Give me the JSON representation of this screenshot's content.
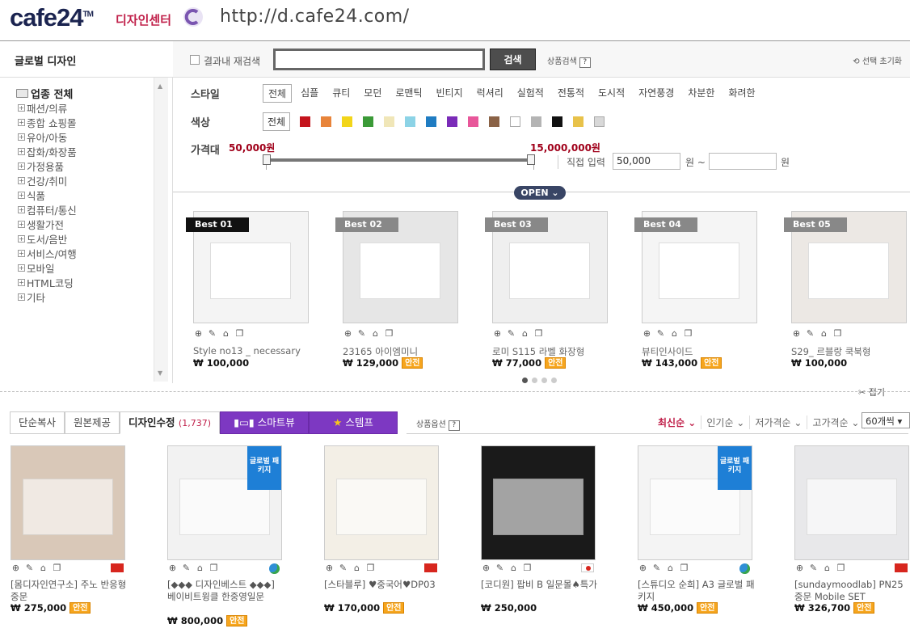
{
  "header": {
    "logo": "cafe24",
    "logo_tm": "TM",
    "logo_sub": "디자인센터",
    "url": "http://d.cafe24.com/"
  },
  "left": {
    "title": "글로벌 디자인",
    "root": "업종 전체",
    "categories": [
      "패션/의류",
      "종합 쇼핑몰",
      "유아/아동",
      "잡화/화장품",
      "가정용품",
      "건강/취미",
      "식품",
      "컴퓨터/통신",
      "생활가전",
      "도서/음반",
      "서비스/여행",
      "모바일",
      "HTML코딩",
      "기타"
    ]
  },
  "search": {
    "research_label": "결과내 재검색",
    "button": "검색",
    "product_search_label": "상품검색",
    "help": "?",
    "reset_label": "선택 초기화"
  },
  "filters": {
    "style_label": "스타일",
    "styles": [
      "전체",
      "심플",
      "큐티",
      "모던",
      "로맨틱",
      "빈티지",
      "럭셔리",
      "실험적",
      "전통적",
      "도시적",
      "자연풍경",
      "차분한",
      "화려한"
    ],
    "color_label": "색상",
    "color_all": "전체",
    "colors": [
      "#c4141c",
      "#e8843a",
      "#f2d51a",
      "#3b9a37",
      "#f0e6b8",
      "#8cd3e6",
      "#1f7cc2",
      "#7a2bb8",
      "#e8579a",
      "#8a6246",
      "#ffffff",
      "#b4b4b4",
      "#111111",
      "#e8c24a",
      "#d8d8d8"
    ],
    "price_label": "가격대",
    "price_min": "50,000원",
    "price_max": "15,000,000원",
    "direct_label": "직접 입력",
    "input_min": "50,000",
    "unit_from": "원 ~",
    "unit_to": "원",
    "open_label": "OPEN"
  },
  "best": [
    {
      "badge": "Best 01",
      "name": "Style no13 _ necessary",
      "price": "₩ 100,000",
      "safe": ""
    },
    {
      "badge": "Best 02",
      "name": "23165 아이엠미니",
      "price": "₩ 129,000",
      "safe": "안전"
    },
    {
      "badge": "Best 03",
      "name": "로미 S115 라벨 화장형",
      "price": "₩ 77,000",
      "safe": "안전"
    },
    {
      "badge": "Best 04",
      "name": "뷰티인사이드",
      "price": "₩ 143,000",
      "safe": "안전"
    },
    {
      "badge": "Best 05",
      "name": "S29_ 르블랑 쿡북형",
      "price": "₩ 100,000",
      "safe": ""
    }
  ],
  "fold_label": "접기",
  "tabs": {
    "simple_copy": "단순복사",
    "original": "원본제공",
    "design_edit": "디자인수정",
    "design_edit_count": "(1,737)",
    "smart_view": "스마트뷰",
    "template": "스템프",
    "product_option": "상품옵션"
  },
  "sort": {
    "options": [
      "최신순",
      "인기순",
      "저가격순",
      "고가격순"
    ],
    "per_page": "60개씩"
  },
  "package_label": "글로벌 패키지",
  "products": [
    {
      "name": "[몸디자인연구소] 주노 반응형 중문",
      "price": "₩ 275,000",
      "safe": "안전",
      "flag": "cn",
      "package": false
    },
    {
      "name": "[◆◆◆ 디자인베스트 ◆◆◆] 베이비트윙클 한중영일문",
      "price": "₩ 800,000",
      "safe": "안전",
      "flag": "globe",
      "package": true
    },
    {
      "name": "[스타블루] ♥중국어♥DP03",
      "price": "₩ 170,000",
      "safe": "안전",
      "flag": "cn",
      "package": false
    },
    {
      "name": "[코디원] 팝비 B 일문몰♠특가",
      "price": "₩ 250,000",
      "safe": "",
      "flag": "jp",
      "package": false
    },
    {
      "name": "[스튜디오 순희] A3 글로벌 패키지",
      "price": "₩ 450,000",
      "safe": "안전",
      "flag": "globe",
      "package": true
    },
    {
      "name": "[sundaymoodlab] PN25 중문 Mobile SET",
      "price": "₩ 326,700",
      "safe": "안전",
      "flag": "cn",
      "package": false
    }
  ]
}
